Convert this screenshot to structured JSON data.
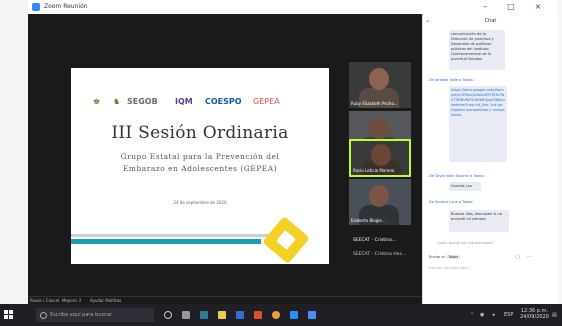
{
  "window": {
    "title": "Zoom Reunión",
    "minimize": "–",
    "maximize": "□",
    "close": "×"
  },
  "slide": {
    "logos": [
      "SEGOB",
      "IQM",
      "COESPO",
      "GEPEA"
    ],
    "title": "III Sesión Ordinaria",
    "subtitle_line1": "Grupo Estatal para la Prevención del",
    "subtitle_line2": "Embarazo en Adolescentes (GEPEA)",
    "date": "24 de septiembre de 2020"
  },
  "participants": [
    {
      "name": "Ruby Elizabeth Pecho..."
    },
    {
      "name": "Ventanaaz"
    },
    {
      "name": "Rocío Leticia Moreno"
    },
    {
      "name": "Eroberto Blogie..."
    }
  ],
  "participant_labels": [
    "SEECAT - Cristina...",
    "SEECAT - Cristina Hes..."
  ],
  "meeting_toolbar": {
    "left": "Pause / Cancel",
    "middle": "Mejorar 3",
    "right": "Ayudar Multitas"
  },
  "chat": {
    "title": "Chat",
    "messages": [
      {
        "from": "",
        "text": "comunicación de la Dirección de Juventud y Desarrollo de políticas públicas del Instituto Quintanarroense de la Juventud Saludos"
      },
      {
        "from": "De Jangela Valle a Todos:",
        "text": "https://docs.google.com/forms/d/e/1FAIpQLSeAcD9TSHs7WVTSNNVNFOO6fbRQpq7N6A/viewform?usp=sf_link, link de registro compañeros y compañeras."
      },
      {
        "from": "De Silvia Valle Álvarez a Todos:",
        "text": "Gracias Lau"
      },
      {
        "from": "De Sandra Luna a Todos:",
        "text": "Buenos días, disculpen si no encendí mi cámara"
      }
    ],
    "search_placeholder": "Quién puede ver tus mensajes?",
    "to_label": "Enviar a:",
    "to_value": "Todos",
    "input_placeholder": "Escribir mensaje aquí..."
  },
  "taskbar": {
    "search_placeholder": "Escriba aquí para buscar",
    "time": "12:36 p.m.",
    "date": "24/09/2020",
    "lang": "ESP"
  },
  "colors": {
    "meeting_bg": "#1a1a1a",
    "teal": "#1a9fb0",
    "active_speaker": "#b9ff3d",
    "zoom_blue": "#2d8cff"
  }
}
